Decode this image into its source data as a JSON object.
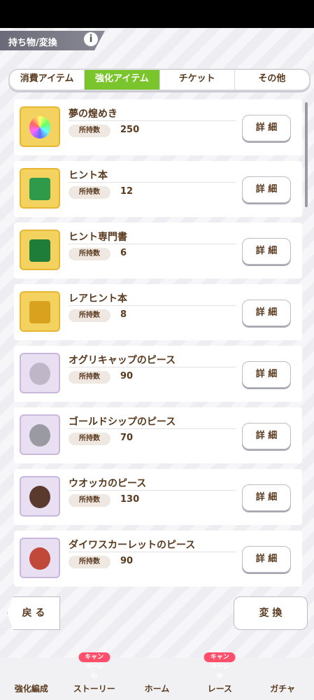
{
  "header": {
    "title": "持ち物/変換",
    "info_icon": "i"
  },
  "tabs": [
    {
      "label": "消費アイテム",
      "active": false
    },
    {
      "label": "強化アイテム",
      "active": true
    },
    {
      "label": "チケット",
      "active": false
    },
    {
      "label": "その他",
      "active": false
    }
  ],
  "items": [
    {
      "name": "夢の煌めき",
      "count_label": "所持数",
      "count": "250",
      "detail_label": "詳 細",
      "icon": "rainbow-gem-icon"
    },
    {
      "name": "ヒント本",
      "count_label": "所持数",
      "count": "12",
      "detail_label": "詳 細",
      "icon": "green-book-icon"
    },
    {
      "name": "ヒント専門書",
      "count_label": "所持数",
      "count": "6",
      "detail_label": "詳 細",
      "icon": "green-book-icon"
    },
    {
      "name": "レアヒント本",
      "count_label": "所持数",
      "count": "8",
      "detail_label": "詳 細",
      "icon": "gold-book-icon"
    },
    {
      "name": "オグリキャップのピース",
      "count_label": "所持数",
      "count": "90",
      "detail_label": "詳 細",
      "icon": "character-piece-icon"
    },
    {
      "name": "ゴールドシップのピース",
      "count_label": "所持数",
      "count": "70",
      "detail_label": "詳 細",
      "icon": "character-piece-icon"
    },
    {
      "name": "ウオッカのピース",
      "count_label": "所持数",
      "count": "130",
      "detail_label": "詳 細",
      "icon": "character-piece-icon"
    },
    {
      "name": "ダイワスカーレットのピース",
      "count_label": "所持数",
      "count": "90",
      "detail_label": "詳 細",
      "icon": "character-piece-icon"
    }
  ],
  "footer": {
    "back_label": "戻 る",
    "convert_label": "変 換"
  },
  "nav": [
    {
      "label": "強化編成"
    },
    {
      "label": "ストーリー",
      "badge": "キャンペーン中"
    },
    {
      "label": "ホーム"
    },
    {
      "label": "レース",
      "badge": "キャンペーン中"
    },
    {
      "label": "ガチャ"
    }
  ]
}
